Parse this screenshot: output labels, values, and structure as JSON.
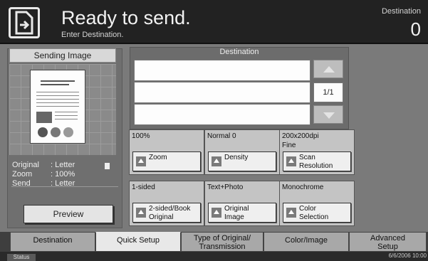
{
  "header": {
    "title": "Ready to send.",
    "subtitle": "Enter Destination.",
    "destination_label": "Destination",
    "destination_count": "0"
  },
  "left": {
    "sending_image_label": "Sending Image",
    "original_key": "Original",
    "original_value": ": Letter",
    "zoom_key": "Zoom",
    "zoom_value": ": 100%",
    "send_key": "Send",
    "send_value": ": Letter",
    "preview_label": "Preview"
  },
  "destination": {
    "title": "Destination",
    "page_indicator": "1/1"
  },
  "settings": [
    {
      "value": "100%",
      "button": "Zoom"
    },
    {
      "value": "Normal 0",
      "button": "Density"
    },
    {
      "value": "200x200dpi\nFine",
      "button": "Scan\nResolution"
    },
    {
      "value": "1-sided",
      "button": "2-sided/Book\nOriginal"
    },
    {
      "value": "Text+Photo",
      "button": "Original\nImage"
    },
    {
      "value": "Monochrome",
      "button": "Color\nSelection"
    }
  ],
  "tabs": [
    {
      "label": "Destination"
    },
    {
      "label": "Quick Setup"
    },
    {
      "label": "Type of Original/\nTransmission"
    },
    {
      "label": "Color/Image"
    },
    {
      "label": "Advanced\nSetup"
    }
  ],
  "status": {
    "status_label": "Status",
    "datetime": "6/6/2006 10:00"
  }
}
